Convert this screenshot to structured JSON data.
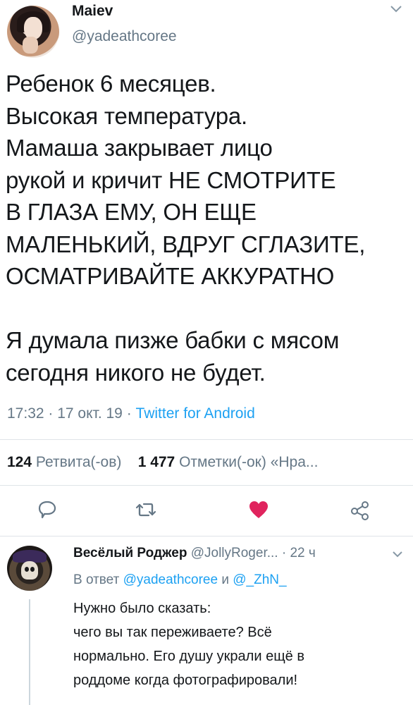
{
  "tweet": {
    "display_name": "Maiev",
    "username": "@yadeathcoree",
    "text": "Ребенок 6 месяцев.\nВысокая температура.\nМамаша закрывает лицо\nрукой и кричит НЕ СМОТРИТЕ\nВ ГЛАЗА ЕМУ, ОН ЕЩЕ\nМАЛЕНЬКИЙ, ВДРУГ СГЛАЗИТЕ,\nОСМАТРИВАЙТЕ АККУРАТНО\n\nЯ думала пизже бабки с мясом\nсегодня никого не будет.",
    "time": "17:32",
    "date": "17 окт. 19",
    "separator": " · ",
    "source": "Twitter for Android",
    "retweets_count": "124",
    "retweets_label": "Ретвита(-ов)",
    "likes_count": "1 477",
    "likes_label": "Отметки(-ок)",
    "more_label": "«Нра..."
  },
  "actions": {
    "reply": "reply-icon",
    "retweet": "retweet-icon",
    "like": "heart-icon",
    "share": "share-icon",
    "like_color": "#e0245e",
    "icon_color": "#657786"
  },
  "reply": {
    "display_name": "Весёлый Роджер",
    "username": "@JollyRoger...",
    "time": "· 22 ч",
    "reply_prefix": "В ответ",
    "mention1": "@yadeathcoree",
    "conjunction": "и",
    "mention2": "@_ZhN_",
    "text": "Нужно было сказать:\nчего вы так переживаете? Всё\nнормально. Его душу украли ещё в\nроддоме когда фотографировали!"
  },
  "colors": {
    "link": "#1da1f2",
    "muted": "#657786",
    "text": "#14171a",
    "divider": "#dfe4e8"
  }
}
